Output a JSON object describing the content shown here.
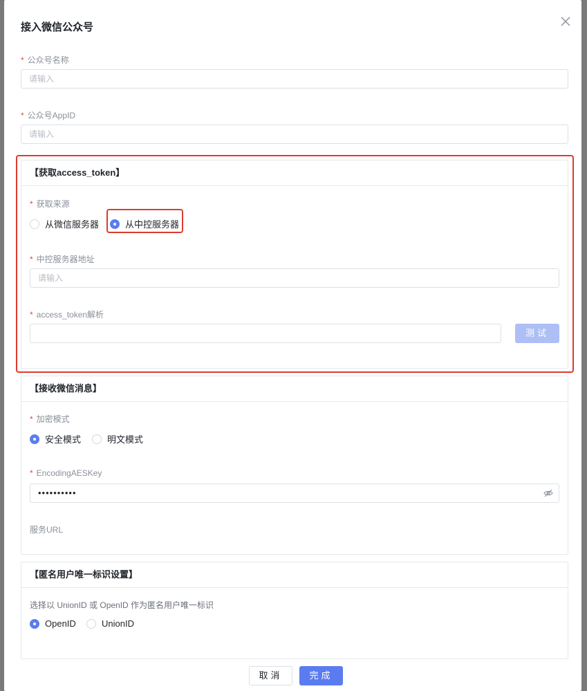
{
  "modal": {
    "title": "接入微信公众号"
  },
  "fields": {
    "name": {
      "label": "公众号名称",
      "placeholder": "请输入"
    },
    "appid": {
      "label": "公众号AppID",
      "placeholder": "请输入"
    }
  },
  "token_section": {
    "title": "【获取access_token】",
    "source_label": "获取来源",
    "source_options": [
      "从微信服务器",
      "从中控服务器"
    ],
    "selected_source": "从中控服务器",
    "server_label": "中控服务器地址",
    "server_placeholder": "请输入",
    "parse_label": "access_token解析",
    "parse_value": "",
    "test_button": "测试"
  },
  "message_section": {
    "title": "【接收微信消息】",
    "encrypt_label": "加密模式",
    "encrypt_options": [
      "安全模式",
      "明文模式"
    ],
    "selected_encrypt": "安全模式",
    "aes_label": "EncodingAESKey",
    "aes_value": "••••••••••",
    "url_label": "服务URL"
  },
  "anon_section": {
    "title": "【匿名用户唯一标识设置】",
    "hint": "选择以 UnionID 或 OpenID 作为匿名用户唯一标识",
    "options": [
      "OpenID",
      "UnionID"
    ],
    "selected": "OpenID"
  },
  "footer": {
    "cancel": "取消",
    "confirm": "完成"
  },
  "colors": {
    "primary": "#5b7cf0",
    "highlight": "#dd3b2c",
    "required": "#e5483b"
  }
}
